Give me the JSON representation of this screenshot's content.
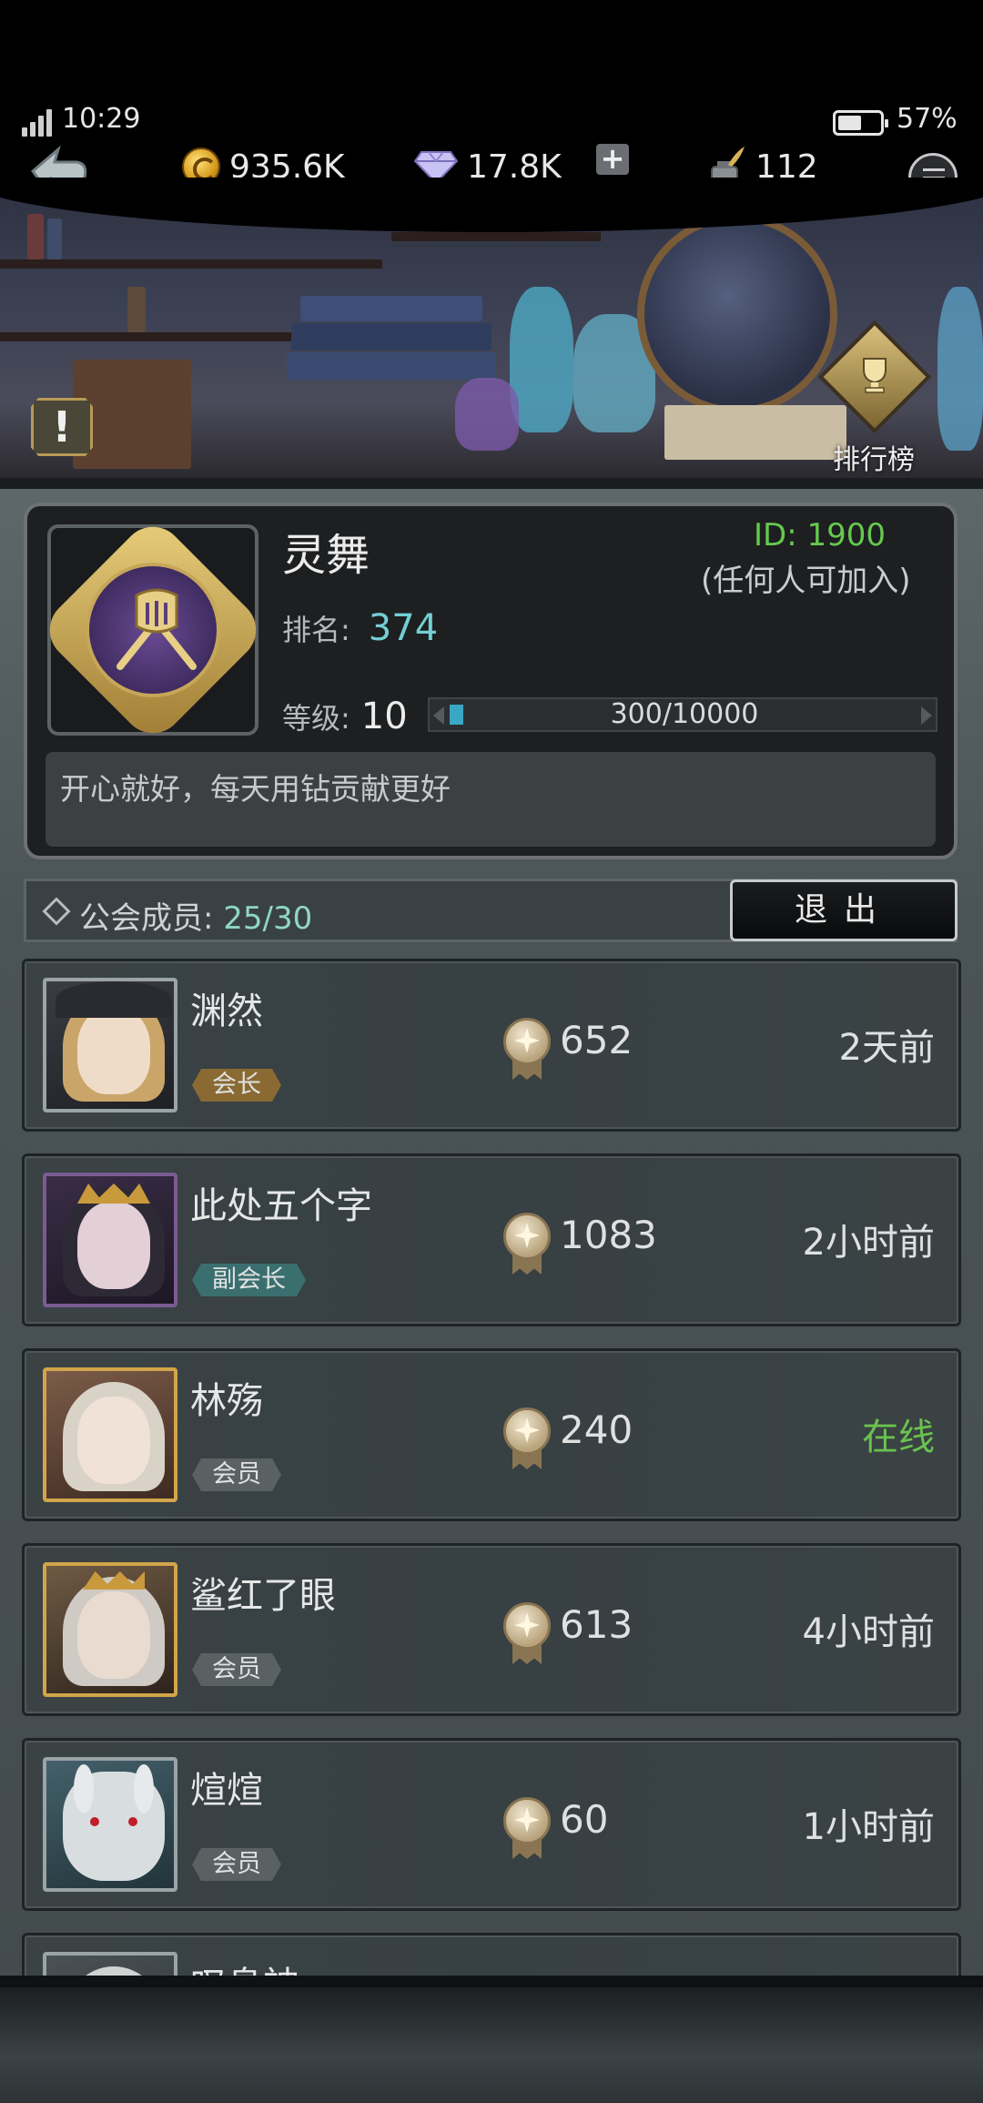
{
  "status_bar": {
    "time": "10:29",
    "battery": "57%",
    "battery_level": 0.57
  },
  "resources": {
    "gold": "935.6K",
    "diamonds": "17.8K",
    "ink": "112"
  },
  "banner": {
    "leaderboard_label": "排行榜",
    "alert_glyph": "!"
  },
  "guild": {
    "name": "灵舞",
    "id_text": "ID: 1900",
    "join_policy": "(任何人可加入)",
    "rank_label": "排名:",
    "rank_value": "374",
    "level_label": "等级:",
    "level_value": "10",
    "xp_text": "300/10000",
    "xp_fraction": 0.03,
    "motto": "开心就好，每天用钻贡献更好"
  },
  "members_header": {
    "label": "公会成员:",
    "count": "25/30",
    "exit_label": "退出"
  },
  "members": [
    {
      "name": "渊然",
      "role": "会长",
      "points": "652",
      "last_seen": "2天前"
    },
    {
      "name": "此处五个字",
      "role": "副会长",
      "points": "1083",
      "last_seen": "2小时前"
    },
    {
      "name": "林殇",
      "role": "会员",
      "points": "240",
      "last_seen": "在线"
    },
    {
      "name": "鲨红了眼",
      "role": "会员",
      "points": "613",
      "last_seen": "4小时前"
    },
    {
      "name": "煊煊",
      "role": "会员",
      "points": "60",
      "last_seen": "1小时前"
    },
    {
      "name": "叹息神",
      "role": "",
      "points": "",
      "last_seen": ""
    }
  ],
  "colors": {
    "accent_cyan": "#74cfd3",
    "online_green": "#6ac24f",
    "id_green": "#66c94d",
    "xp_fill": "#3aa7c4"
  }
}
